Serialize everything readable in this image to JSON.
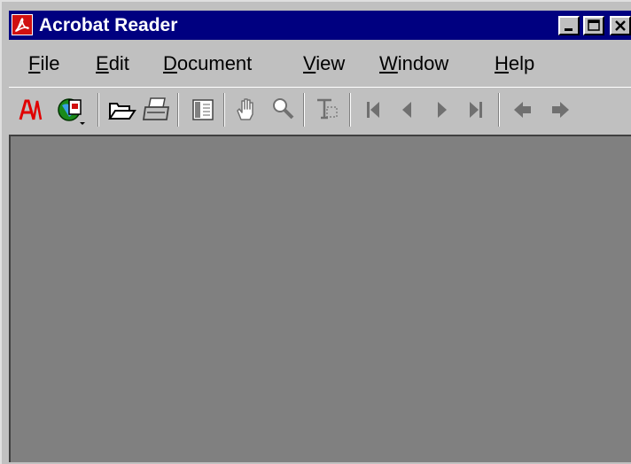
{
  "window": {
    "title": "Acrobat Reader",
    "icon": "acrobat-app-icon",
    "controls": [
      "minimize-icon",
      "maximize-icon",
      "close-icon"
    ]
  },
  "menu": {
    "file": {
      "accel": "F",
      "rest": "ile"
    },
    "edit": {
      "accel": "E",
      "rest": "dit"
    },
    "document": {
      "accel": "D",
      "rest": "ocument"
    },
    "view": {
      "accel": "V",
      "rest": "iew"
    },
    "window": {
      "accel": "W",
      "rest": "indow"
    },
    "help": {
      "accel": "H",
      "rest": "elp"
    }
  },
  "toolbar": {
    "tools": [
      "acrobat-logo-icon",
      "web-link-icon",
      "open-folder-icon",
      "print-icon",
      "page-only-view-icon",
      "hand-tool-icon",
      "zoom-tool-icon",
      "text-select-icon",
      "first-page-icon",
      "previous-page-icon",
      "next-page-icon",
      "last-page-icon",
      "go-back-icon",
      "go-forward-icon"
    ]
  },
  "colors": {
    "titlebar": "#000080",
    "workspace": "#808080",
    "chrome": "#c0c0c0",
    "acrobat_red": "#d01010"
  }
}
